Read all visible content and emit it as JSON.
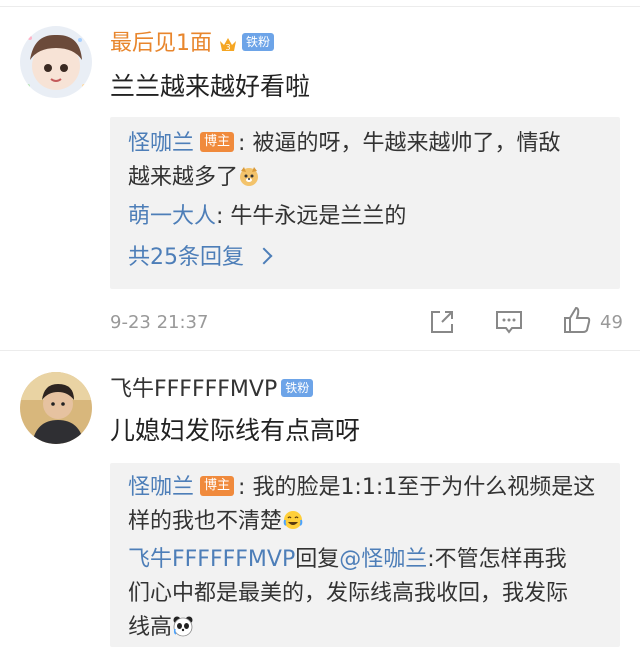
{
  "comment1": {
    "username": "最后见1面",
    "fan_badge": "铁粉",
    "crown_level": "3",
    "content": "兰兰越来越好看啦",
    "replies": {
      "r1_user": "怪咖兰",
      "r1_badge": "博主",
      "r1_text_line1": "被逼的呀，牛越来越帅了，情敌",
      "r1_text_line2": "越来越多了",
      "r2_user": "萌一大人",
      "r2_text": "牛牛永远是兰兰的",
      "more_label": "共25条回复"
    },
    "time": "9-23 21:37",
    "like_count": "49"
  },
  "comment2": {
    "username": "飞牛FFFFFFMVP",
    "fan_badge": "铁粉",
    "content": "儿媳妇发际线有点高呀",
    "replies": {
      "r1_user": "怪咖兰",
      "r1_badge": "博主",
      "r1_text_line1": "我的脸是1:1:1至于为什么视频是这",
      "r1_text_line2": "样的我也不清楚",
      "r2_user": "飞牛FFFFFFMVP",
      "r2_reply_word": "回复",
      "r2_mention": "@怪咖兰",
      "r2_text_line1": ":不管怎样再我",
      "r2_text_line2": "们心中都是最美的，发际线高我收回，我发际",
      "r2_text_line3": "线高"
    }
  },
  "icons": [
    "share-icon",
    "comment-icon",
    "like-icon",
    "crown-icon",
    "dog-emoji-icon",
    "laugh-cry-emoji-icon",
    "panda-emoji-icon",
    "chevron-right-icon"
  ],
  "colors": {
    "username_orange": "#e8862d",
    "link_blue": "#4d7eb8",
    "fan_badge": "#6da4e8",
    "host_badge": "#f08a3c",
    "reply_bg": "#f2f2f2"
  }
}
